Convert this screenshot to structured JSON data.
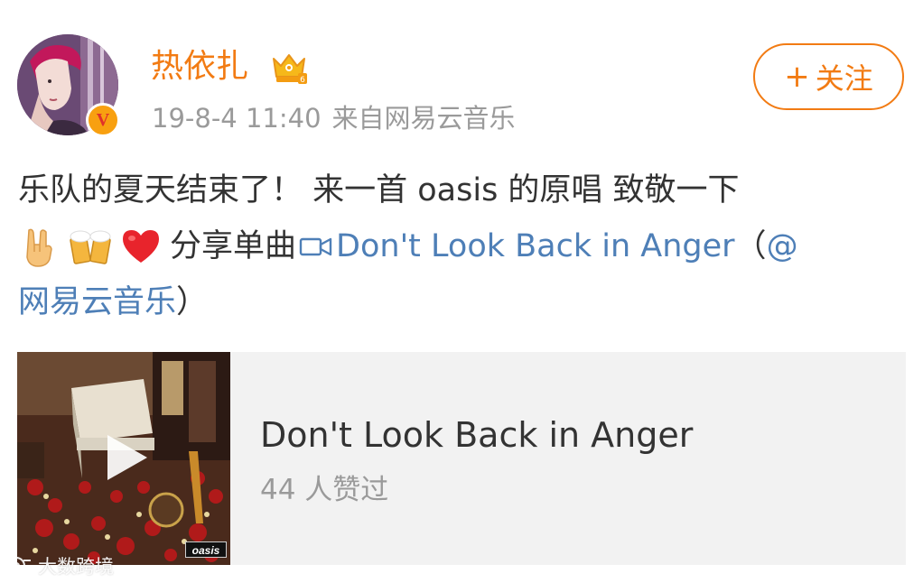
{
  "user": {
    "name": "热依扎",
    "verified_badge_text": "V",
    "timestamp": "19-8-4 11:40",
    "source": "来自网易云音乐",
    "avatar_icon": "avatar-photo",
    "crown_icon": "crown-icon"
  },
  "follow_button": {
    "plus": "+",
    "label": "关注"
  },
  "post": {
    "line1": "乐队的夏天结束了！ 来一首 oasis 的原唱 致敬一下",
    "line2_text": "分享单曲",
    "link_text": "Don't Look Back in Anger",
    "open_paren": "（",
    "mention": "@网易云音乐",
    "mention_part1": "@",
    "mention_part2": "网易云音乐",
    "close_paren": "）",
    "emojis": [
      "rock-hand-icon",
      "beer-mugs-icon",
      "red-heart-icon"
    ]
  },
  "card": {
    "title": "Don't Look Back in Anger",
    "likes": "44 人赞过",
    "cover_label": "oasis"
  },
  "watermark": {
    "text": "大数跨境"
  },
  "colors": {
    "accent_orange": "#f27b13",
    "link_blue": "#4e7fb7",
    "meta_gray": "#9a9a9a",
    "card_bg": "#f2f2f2"
  }
}
